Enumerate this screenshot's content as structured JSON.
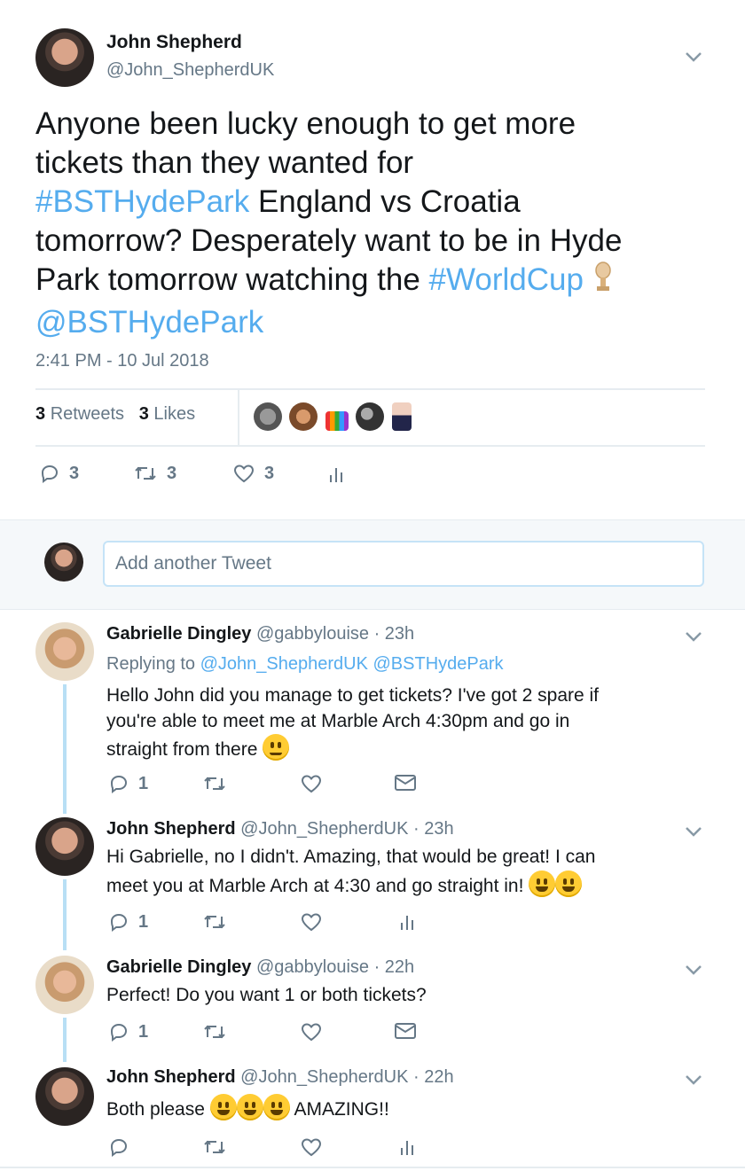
{
  "main_tweet": {
    "author_name": "John Shepherd",
    "author_handle": "@John_ShepherdUK",
    "text_line1": "Anyone been lucky enough to get more",
    "text_line2": "tickets than they wanted for",
    "text_hashtag1": "#BSTHydePark",
    "text_line3_rest": " England vs Croatia",
    "text_line4": "tomorrow? Desperately want to be in Hyde",
    "text_line5": "Park tomorrow watching the ",
    "text_hashtag2": "#WorldCup",
    "text_mention": "@BSTHydePark",
    "timestamp": "2:41 PM - 10 Jul 2018",
    "retweets_count": "3",
    "retweets_label": "Retweets",
    "likes_count": "3",
    "likes_label": "Likes",
    "reply_count": "3",
    "retweet_action_count": "3",
    "like_action_count": "3"
  },
  "composer": {
    "placeholder": "Add another Tweet"
  },
  "replies": [
    {
      "name": "Gabrielle Dingley",
      "handle": "@gabbylouise",
      "time": "· 23h",
      "replying_prefix": "Replying to ",
      "replying_to": "@John_ShepherdUK @BSTHydePark",
      "line1": "Hello John did you manage to get tickets? I've got 2 spare if",
      "line2": "you're able to meet me at Marble Arch 4:30pm and go in",
      "line3": "straight from there",
      "reply_count": "1"
    },
    {
      "name": "John Shepherd",
      "handle": "@John_ShepherdUK",
      "time": "· 23h",
      "line1": "Hi Gabrielle, no I didn't. Amazing, that would be great! I can",
      "line2": "meet you at Marble Arch at 4:30 and go straight in!",
      "reply_count": "1"
    },
    {
      "name": "Gabrielle Dingley",
      "handle": "@gabbylouise",
      "time": "· 22h",
      "line1": "Perfect! Do you want 1 or both tickets?",
      "reply_count": "1"
    },
    {
      "name": "John Shepherd",
      "handle": "@John_ShepherdUK",
      "time": "· 22h",
      "line1": "Both please",
      "line1_end": "AMAZING!!"
    }
  ],
  "icons": {
    "chevron": "chevron-down-icon",
    "reply": "reply-icon",
    "retweet": "retweet-icon",
    "like": "heart-icon",
    "analytics": "analytics-icon",
    "dm": "envelope-icon"
  },
  "colors": {
    "link": "#55acee",
    "muted": "#657786",
    "thread": "#b8dff5",
    "composer_bg": "#f5f8fa"
  }
}
